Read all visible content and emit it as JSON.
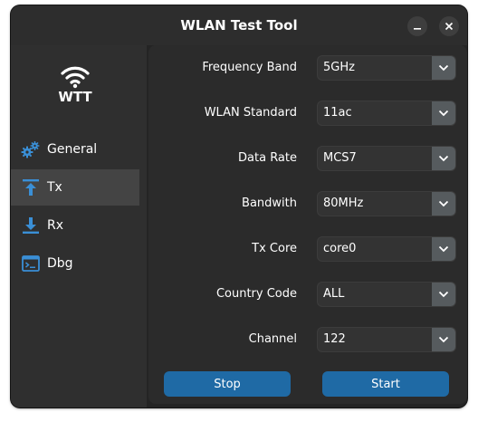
{
  "window": {
    "title": "WLAN Test Tool",
    "controls": {
      "minimize": "–",
      "close": "✕"
    }
  },
  "sidebar": {
    "logo_text": "WTT",
    "logo_icon": "wifi-icon",
    "items": [
      {
        "label": "General",
        "icon": "gears-icon",
        "active": false
      },
      {
        "label": "Tx",
        "icon": "upload-arrow-icon",
        "active": true
      },
      {
        "label": "Rx",
        "icon": "download-arrow-icon",
        "active": false
      },
      {
        "label": "Dbg",
        "icon": "terminal-icon",
        "active": false
      }
    ]
  },
  "form": {
    "fields": [
      {
        "label": "Frequency Band",
        "value": "5GHz"
      },
      {
        "label": "WLAN Standard",
        "value": "11ac"
      },
      {
        "label": "Data Rate",
        "value": "MCS7"
      },
      {
        "label": "Bandwith",
        "value": "80MHz"
      },
      {
        "label": "Tx Core",
        "value": "core0"
      },
      {
        "label": "Country Code",
        "value": "ALL"
      },
      {
        "label": "Channel",
        "value": "122"
      }
    ]
  },
  "buttons": {
    "stop": "Stop",
    "start": "Start"
  },
  "colors": {
    "accent": "#1f6aa5",
    "window_bg": "#242424",
    "sidebar_bg": "#2f2f2f",
    "active_item": "#444444",
    "icon_blue": "#3a8fd6"
  }
}
